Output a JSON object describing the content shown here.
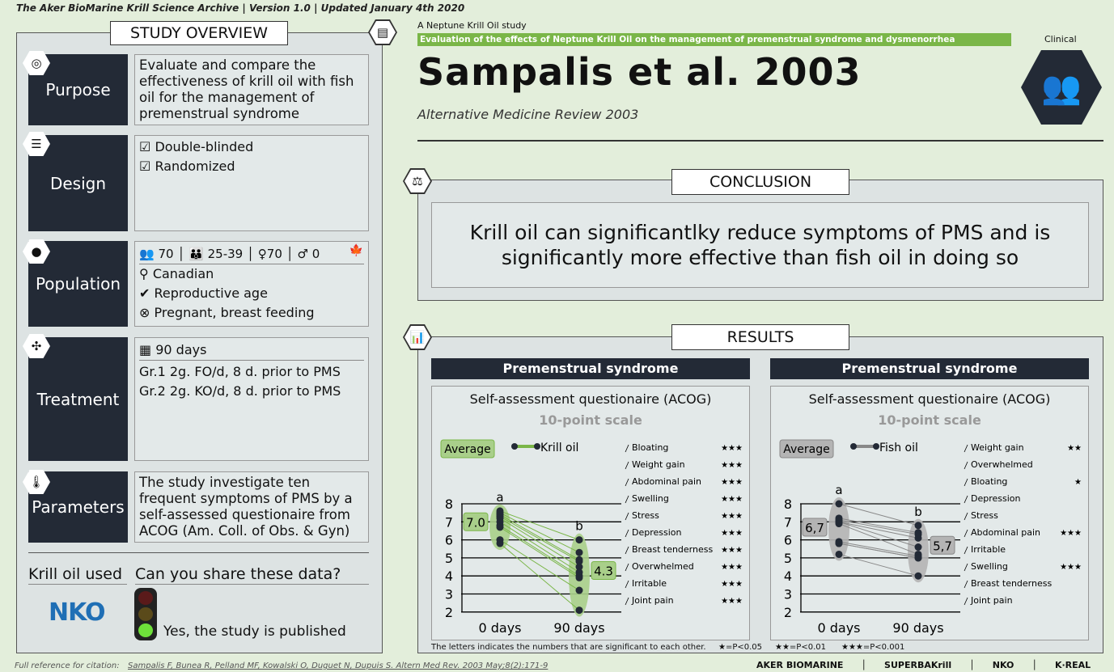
{
  "header": {
    "archive_line": "The Aker BioMarine Krill Science Archive | Version 1.0 | Updated January 4th 2020",
    "kicker": "A Neptune Krill Oil study",
    "subtitle_bar": "Evaluation of the effects of Neptune Krill Oil on the management of premenstrual syndrome and dysmenorrhea",
    "title": "Sampalis et al. 2003",
    "journal": "Alternative Medicine Review 2003",
    "category": "Clinical",
    "accent": "#7ab648"
  },
  "overview": {
    "title": "STUDY OVERVIEW",
    "purpose": {
      "label": "Purpose",
      "text": "Evaluate and compare the effectiveness of krill oil with fish oil for the management of premenstrual syndrome"
    },
    "design": {
      "label": "Design",
      "items": [
        "Double-blinded",
        "Randomized"
      ]
    },
    "population": {
      "label": "Population",
      "total": "70",
      "age": "25-39",
      "female": "70",
      "male": "0",
      "country": "Canadian",
      "inclusion": "Reproductive age",
      "exclusion": "Pregnant, breast feeding"
    },
    "treatment": {
      "label": "Treatment",
      "duration": "90 days",
      "groups": [
        "Gr.1  2g. FO/d, 8 d. prior to PMS",
        "Gr.2  2g. KO/d, 8 d. prior to PMS"
      ]
    },
    "parameters": {
      "label": "Parameters",
      "text": "The study investigate ten frequent symptoms of PMS by a self-assessed questionaire from ACOG (Am. Coll. of Obs. & Gyn)"
    },
    "krill_used_label": "Krill oil used",
    "brand": "NKO",
    "share_label": "Can you share these data?",
    "share_answer": "Yes, the study is published"
  },
  "conclusion": {
    "title": "CONCLUSION",
    "text": "Krill oil can significantlky reduce symptoms of PMS and is significantly more effective than fish oil in doing so"
  },
  "results": {
    "title": "RESULTS",
    "footnote": "The letters indicates the numbers that are significant to each other.",
    "legend_sig": [
      "★=P<0.05",
      "★★=P<0.01",
      "★★★=P<0.001"
    ]
  },
  "chart_data": [
    {
      "type": "line",
      "panel_title": "Premenstrual syndrome",
      "title": "Self-assessment questionaire (ACOG)",
      "subtitle": "10-point scale",
      "average_label": "Average",
      "series_name": "Krill oil",
      "color": "#7ab648",
      "categories": [
        "0 days",
        "90 days"
      ],
      "ylim": [
        2,
        8
      ],
      "yticks": [
        2,
        3,
        4,
        5,
        6,
        7,
        8
      ],
      "letters": [
        "a",
        "b"
      ],
      "averages": [
        "7.0",
        "4.3"
      ],
      "symptoms": [
        {
          "name": "Bloating",
          "sig": "★★★"
        },
        {
          "name": "Weight gain",
          "sig": "★★★"
        },
        {
          "name": "Abdominal pain",
          "sig": "★★★"
        },
        {
          "name": "Swelling",
          "sig": "★★★"
        },
        {
          "name": "Stress",
          "sig": "★★★"
        },
        {
          "name": "Depression",
          "sig": "★★★"
        },
        {
          "name": "Breast tenderness",
          "sig": "★★★"
        },
        {
          "name": "Overwhelmed",
          "sig": "★★★"
        },
        {
          "name": "Irritable",
          "sig": "★★★"
        },
        {
          "name": "Joint pain",
          "sig": "★★★"
        }
      ],
      "values": [
        [
          7.6,
          6.0
        ],
        [
          7.5,
          5.3
        ],
        [
          7.4,
          4.9
        ],
        [
          7.3,
          4.8
        ],
        [
          7.2,
          4.5
        ],
        [
          7.0,
          4.2
        ],
        [
          6.8,
          4.0
        ],
        [
          6.7,
          3.9
        ],
        [
          6.0,
          3.2
        ],
        [
          5.8,
          2.1
        ]
      ]
    },
    {
      "type": "line",
      "panel_title": "Premenstrual syndrome",
      "title": "Self-assessment questionaire (ACOG)",
      "subtitle": "10-point scale",
      "average_label": "Average",
      "series_name": "Fish oil",
      "color": "#888888",
      "categories": [
        "0 days",
        "90 days"
      ],
      "ylim": [
        2,
        8
      ],
      "yticks": [
        2,
        3,
        4,
        5,
        6,
        7,
        8
      ],
      "letters": [
        "a",
        "b"
      ],
      "averages": [
        "6,7",
        "5,7"
      ],
      "symptoms": [
        {
          "name": "Weight gain",
          "sig": "★★"
        },
        {
          "name": "Overwhelmed",
          "sig": ""
        },
        {
          "name": "Bloating",
          "sig": "★"
        },
        {
          "name": "Depression",
          "sig": ""
        },
        {
          "name": "Stress",
          "sig": ""
        },
        {
          "name": "Abdominal pain",
          "sig": "★★★"
        },
        {
          "name": "Irritable",
          "sig": ""
        },
        {
          "name": "Swelling",
          "sig": "★★★"
        },
        {
          "name": "Breast tenderness",
          "sig": ""
        },
        {
          "name": "Joint pain",
          "sig": ""
        }
      ],
      "values": [
        [
          8.0,
          6.8
        ],
        [
          7.2,
          6.4
        ],
        [
          7.1,
          6.3
        ],
        [
          7.0,
          6.1
        ],
        [
          7.0,
          5.6
        ],
        [
          6.9,
          5.2
        ],
        [
          5.9,
          5.1
        ],
        [
          5.8,
          5.0
        ],
        [
          5.8,
          5.0
        ],
        [
          5.2,
          4.0
        ]
      ]
    }
  ],
  "footer": {
    "citation_label": "Full reference for citation:",
    "citation": "Sampalis F, Bunea R, Pelland MF, Kowalski O, Duguet N, Dupuis S. Altern Med Rev. 2003 May;8(2):171-9",
    "logos": [
      "AKER BIOMARINE",
      "SUPERBAKrill",
      "NKO",
      "K·REAL"
    ]
  }
}
